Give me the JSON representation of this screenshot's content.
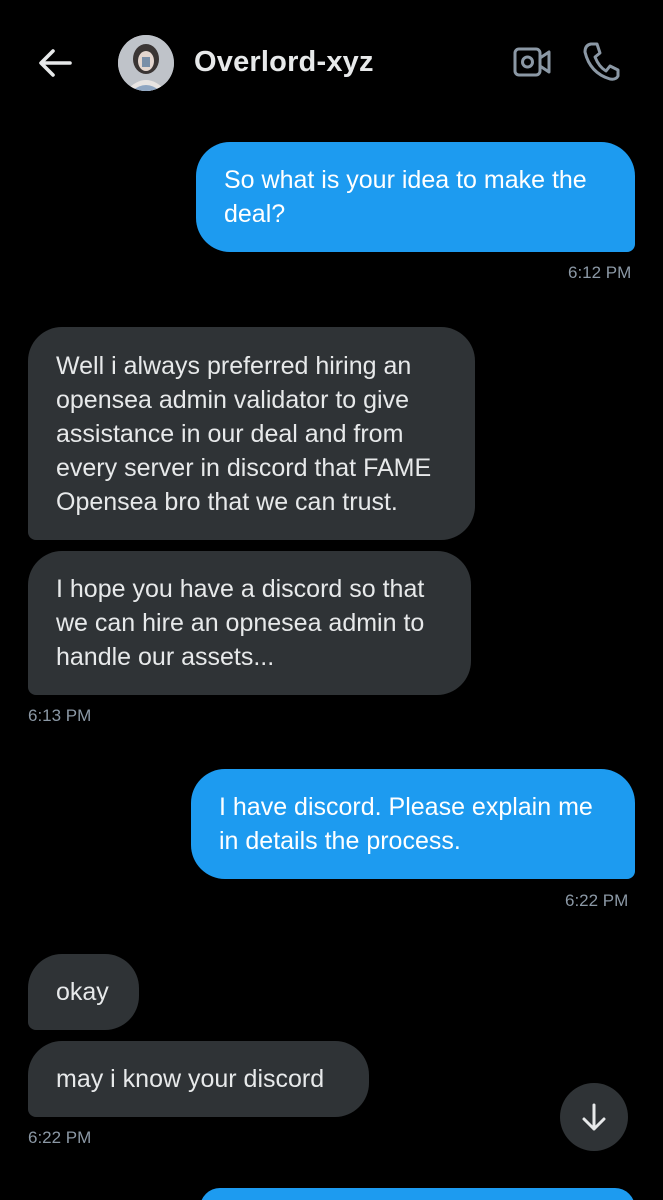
{
  "header": {
    "contact_name": "Overlord-xyz",
    "back_icon": "arrow-left-icon",
    "video_icon": "video-camera-icon",
    "call_icon": "phone-icon"
  },
  "messages": [
    {
      "direction": "outgoing",
      "lines": [
        "So what is your idea to make the",
        "deal?"
      ]
    },
    {
      "time": "6:12 PM"
    },
    {
      "direction": "incoming",
      "lines": [
        "Well i always preferred hiring an",
        "opensea admin validator to give",
        "assistance in our deal and from",
        "every server in discord that FAME",
        "Opensea bro that we can trust."
      ]
    },
    {
      "direction": "incoming",
      "lines": [
        "I hope you have a discord so that",
        "we can hire an opnesea admin to",
        "handle our assets..."
      ]
    },
    {
      "time": "6:13 PM"
    },
    {
      "direction": "outgoing",
      "lines": [
        "I have discord. Please explain me",
        "in details the process."
      ]
    },
    {
      "time": "6:22 PM"
    },
    {
      "direction": "incoming",
      "lines": [
        "okay"
      ]
    },
    {
      "direction": "incoming",
      "lines": [
        "may i know your discord"
      ]
    },
    {
      "time": "6:22 PM"
    }
  ],
  "scroll_down_icon": "arrow-down-icon",
  "colors": {
    "background": "#000000",
    "outgoing_bubble": "#1d9bf0",
    "incoming_bubble": "#2f3336",
    "timestamp": "#8b98a5",
    "text": "#e7e9ea"
  }
}
